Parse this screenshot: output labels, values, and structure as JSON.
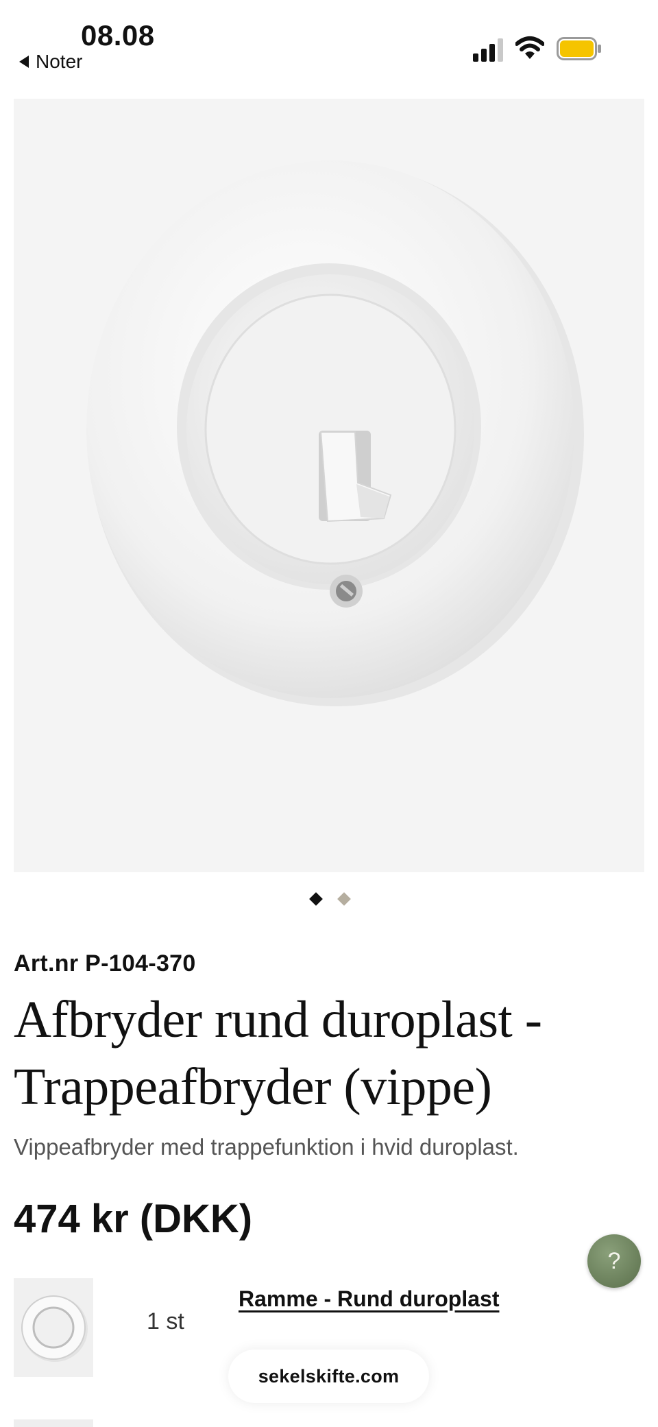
{
  "status_bar": {
    "time": "08.08",
    "back_label": "Noter",
    "battery_color": "#f5c400"
  },
  "gallery": {
    "image_alt": "Afbryder rund duroplast",
    "page_count": 2,
    "active_page": 1
  },
  "product": {
    "art_nr": "Art.nr P-104-370",
    "title_line1": "Afbryder rund duroplast -",
    "title_line2": "Trappeafbryder (vippe)",
    "description": "Vippeafbryder med trappefunktion i hvid duroplast.",
    "price": "474 kr (DKK)"
  },
  "help": {
    "label": "?",
    "color": "#6b7f5b"
  },
  "accessories": [
    {
      "quantity": "1 st",
      "name": "Ramme - Rund duroplast",
      "icon": "round-frame-thumbnail"
    }
  ],
  "browser": {
    "domain": "sekelskifte.com"
  }
}
